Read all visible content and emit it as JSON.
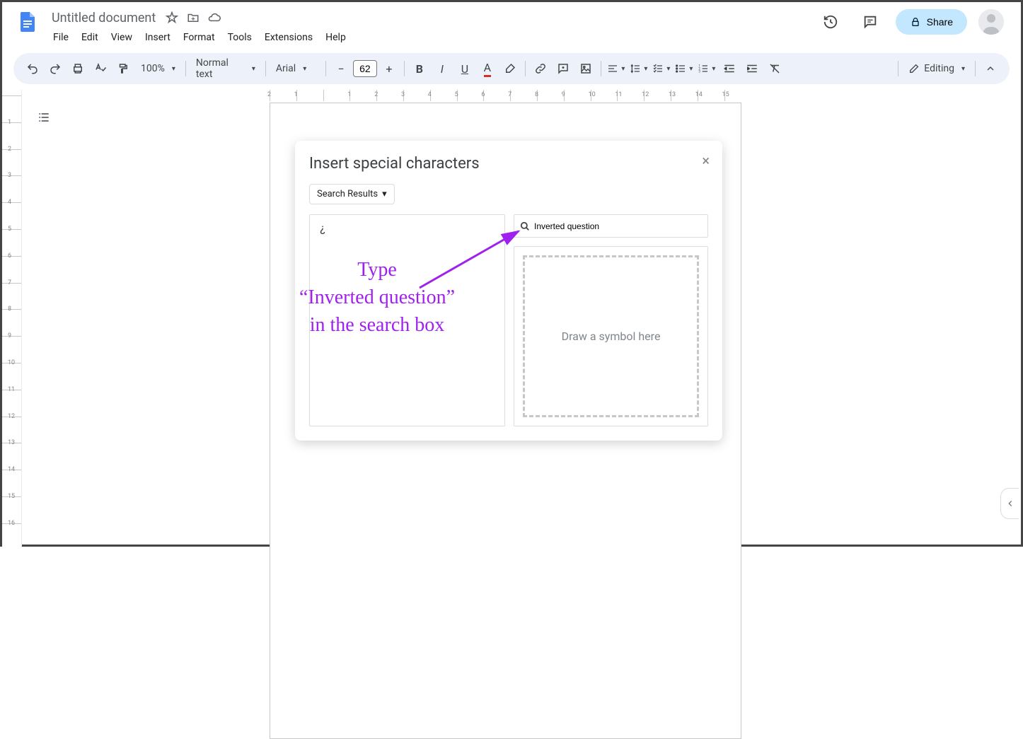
{
  "doc": {
    "title": "Untitled document"
  },
  "menus": [
    "File",
    "Edit",
    "View",
    "Insert",
    "Format",
    "Tools",
    "Extensions",
    "Help"
  ],
  "share": {
    "label": "Share"
  },
  "toolbar": {
    "zoom": "100%",
    "style": "Normal text",
    "font": "Arial",
    "size": "62",
    "editing": "Editing"
  },
  "dialog": {
    "title": "Insert special characters",
    "dropdown": "Search Results",
    "result_char": "¿",
    "search_value": "Inverted question",
    "draw_hint": "Draw a symbol here"
  },
  "annotation": {
    "line1": "Type",
    "line2": "“Inverted question”",
    "line3": "in the search box"
  }
}
